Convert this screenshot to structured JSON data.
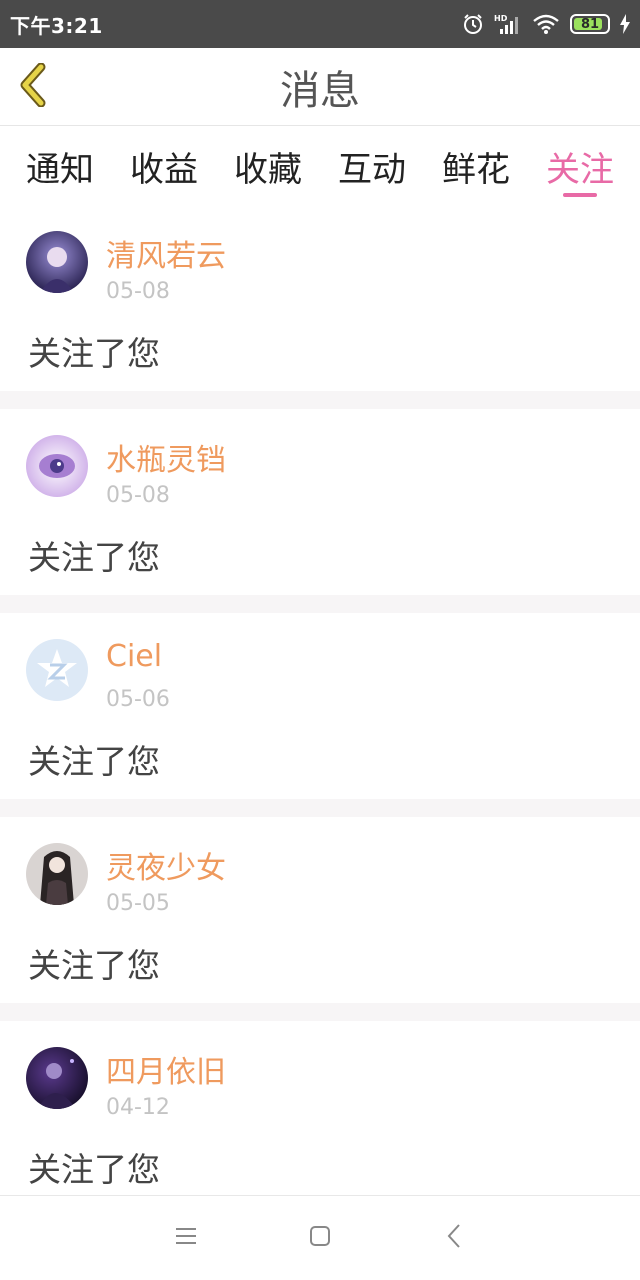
{
  "status_bar": {
    "time": "下午3:21",
    "signal_label": "HD",
    "battery": "81"
  },
  "header": {
    "title": "消息",
    "back_icon": "chevron-left-icon"
  },
  "tabs": [
    {
      "label": "通知",
      "active": false
    },
    {
      "label": "收益",
      "active": false
    },
    {
      "label": "收藏",
      "active": false
    },
    {
      "label": "互动",
      "active": false
    },
    {
      "label": "鲜花",
      "active": false
    },
    {
      "label": "关注",
      "active": true
    }
  ],
  "notifications": [
    {
      "name": "清风若云",
      "date": "05-08",
      "message": "关注了您"
    },
    {
      "name": "水瓶灵铛",
      "date": "05-08",
      "message": "关注了您"
    },
    {
      "name": "Ciel",
      "date": "05-06",
      "message": "关注了您"
    },
    {
      "name": "灵夜少女",
      "date": "05-05",
      "message": "关注了您"
    },
    {
      "name": "四月依旧",
      "date": "04-12",
      "message": "关注了您"
    }
  ],
  "colors": {
    "accent": "#e86aa6",
    "name": "#ef9a5e",
    "back_icon": "#d8c83a"
  },
  "nav_bar": {
    "icons": [
      "menu-icon",
      "home-square-icon",
      "back-icon"
    ]
  }
}
